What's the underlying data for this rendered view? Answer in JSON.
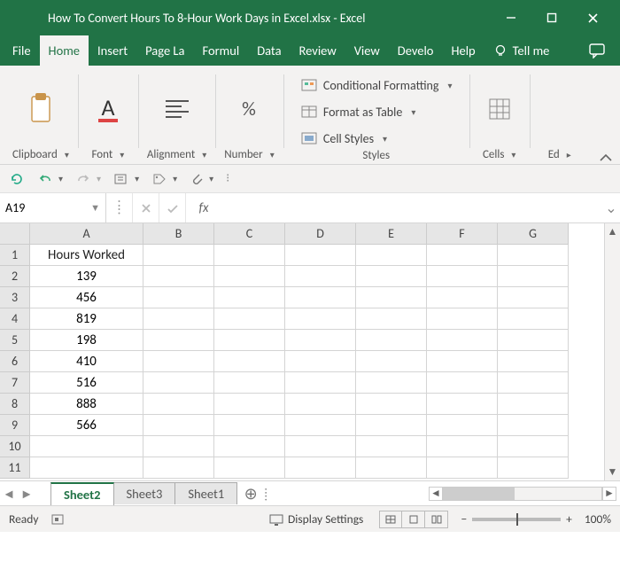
{
  "title": {
    "filename": "How To Convert Hours To 8-Hour Work Days in Excel.xlsx",
    "sep": "  -  ",
    "app": "Excel"
  },
  "tabs": {
    "file": "File",
    "home": "Home",
    "insert": "Insert",
    "page": "Page La",
    "formulas": "Formul",
    "data": "Data",
    "review": "Review",
    "view": "View",
    "developer": "Develo",
    "help": "Help",
    "tellme": "Tell me"
  },
  "ribbon": {
    "clipboard": "Clipboard",
    "font": "Font",
    "alignment": "Alignment",
    "number": "Number",
    "styles": "Styles",
    "cells": "Cells",
    "editing": "Ed",
    "cond_format": "Conditional Formatting",
    "format_table": "Format as Table",
    "cell_styles": "Cell Styles"
  },
  "namebox": "A19",
  "fx": "fx",
  "formula": "",
  "columns": [
    "A",
    "B",
    "C",
    "D",
    "E",
    "F",
    "G"
  ],
  "rows": [
    "1",
    "2",
    "3",
    "4",
    "5",
    "6",
    "7",
    "8",
    "9",
    "10",
    "11"
  ],
  "cells": {
    "A1": "Hours Worked",
    "A2": "139",
    "A3": "456",
    "A4": "819",
    "A5": "198",
    "A6": "410",
    "A7": "516",
    "A8": "888",
    "A9": "566"
  },
  "sheets": {
    "active": "Sheet2",
    "s3": "Sheet3",
    "s1": "Sheet1"
  },
  "status": {
    "ready": "Ready",
    "display": "Display Settings",
    "zoom": "100%"
  }
}
